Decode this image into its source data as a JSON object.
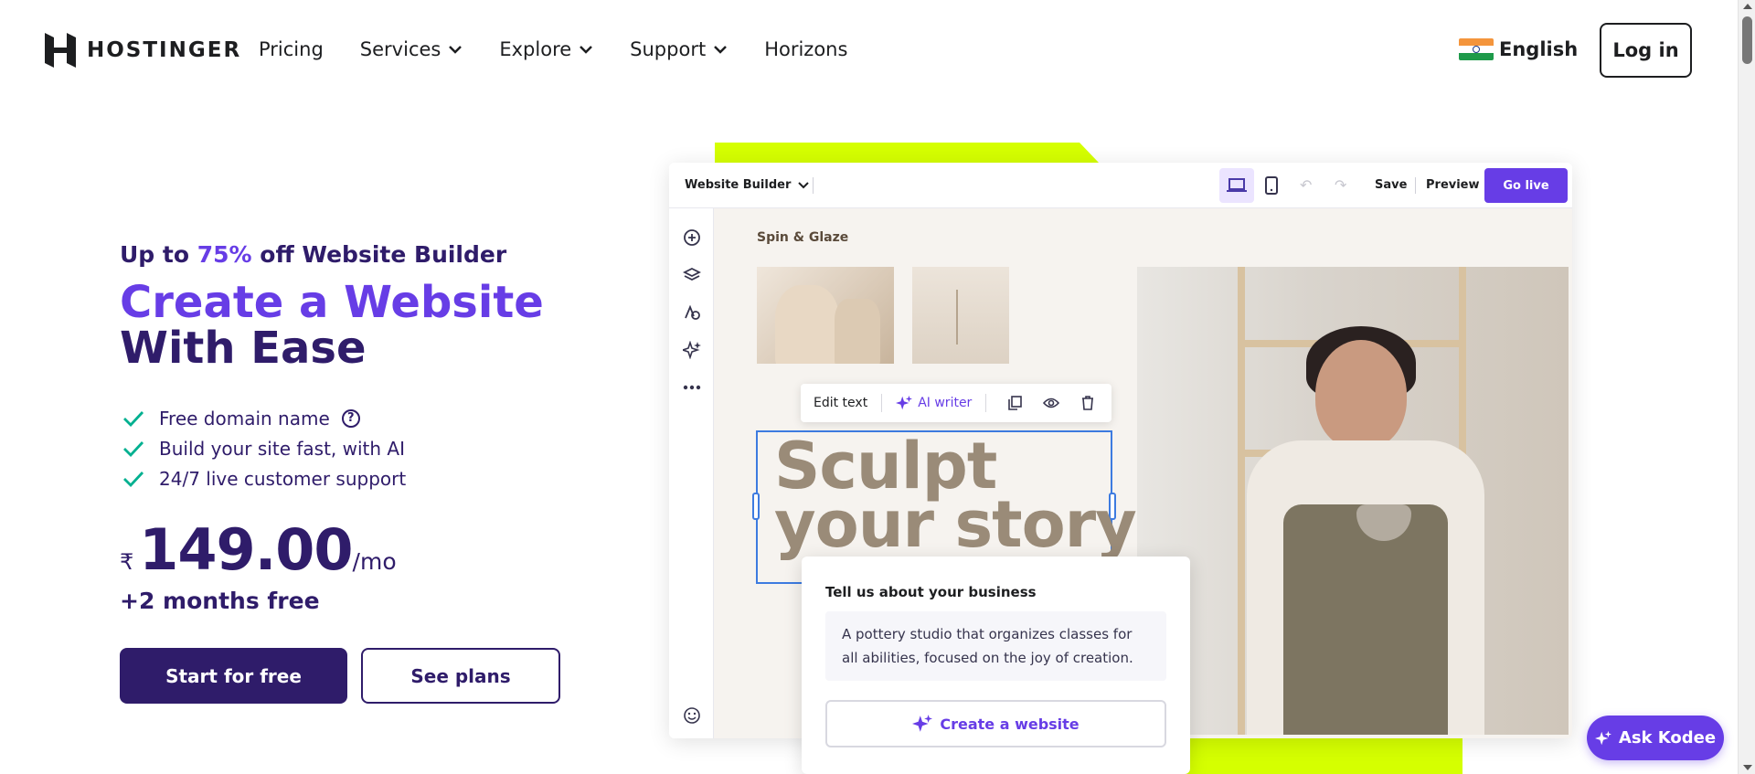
{
  "header": {
    "logo_text": "HOSTINGER",
    "nav": [
      {
        "label": "Pricing",
        "has_dropdown": false
      },
      {
        "label": "Services",
        "has_dropdown": true
      },
      {
        "label": "Explore",
        "has_dropdown": true
      },
      {
        "label": "Support",
        "has_dropdown": true
      },
      {
        "label": "Horizons",
        "has_dropdown": false
      }
    ],
    "language": "English",
    "login_label": "Log in"
  },
  "hero": {
    "promo_prefix": "Up to ",
    "promo_accent": "75%",
    "promo_suffix": " off Website Builder",
    "title_accent": "Create a Website",
    "title_rest": " With Ease",
    "features": [
      "Free domain name",
      "Build your site fast, with AI",
      "24/7 live customer support"
    ],
    "help_icon": "?",
    "currency": "₹",
    "price": "149.00",
    "per": "/mo",
    "bonus": "+2 months free",
    "primary_cta": "Start for free",
    "secondary_cta": "See plans"
  },
  "builder": {
    "title": "Website Builder",
    "save": "Save",
    "preview": "Preview",
    "go_live": "Go live",
    "brand": "Spin & Glaze",
    "edit_text": "Edit text",
    "ai_writer": "AI writer",
    "headline_line1": "Sculpt",
    "headline_line2": "your story",
    "biz_title": "Tell us about your business",
    "biz_text": "A pottery studio that organizes classes for all abilities, focused on the joy of creation.",
    "create_btn": "Create a website"
  },
  "kodee": {
    "label": "Ask Kodee"
  },
  "colors": {
    "brand_purple": "#673de6",
    "navy": "#2f1c6a",
    "lime": "#d5ff00",
    "check_green": "#00b090"
  }
}
